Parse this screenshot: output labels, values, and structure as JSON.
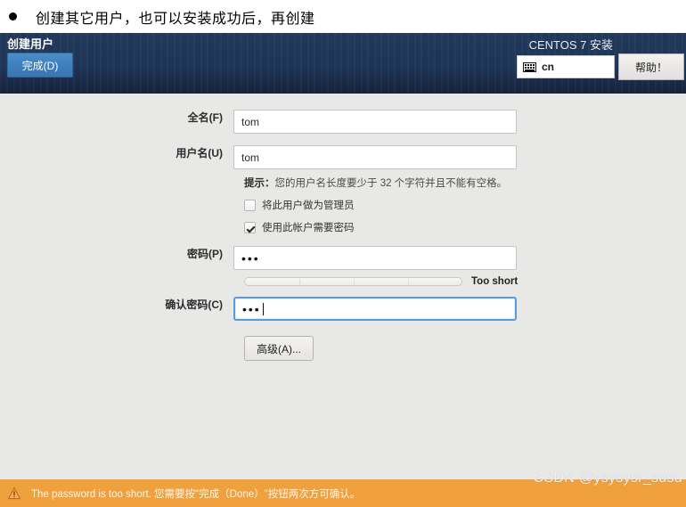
{
  "slide": {
    "bullet_text": "创建其它用户，也可以安装成功后，再创建",
    "bullet_icon": "bullet-dot-icon"
  },
  "header": {
    "title": "创建用户",
    "done_label": "完成(D)",
    "product_title": "CENTOS 7 安装",
    "keyboard_layout": "cn",
    "keyboard_icon": "keyboard-icon",
    "help_label": "帮助！",
    "bg_color": "#1e3557",
    "accent_color": "#3f81bd"
  },
  "form": {
    "fullname": {
      "label": "全名(F)",
      "value": "tom",
      "placeholder": ""
    },
    "username": {
      "label": "用户名(U)",
      "value": "tom",
      "placeholder": ""
    },
    "hint_prefix": "提示：",
    "hint_text": "您的用户名长度要少于 32 个字符并且不能有空格。",
    "admin_checkbox": {
      "label": "将此用户做为管理员",
      "checked": false
    },
    "require_password_checkbox": {
      "label": "使用此帐户需要密码",
      "checked": true
    },
    "password": {
      "label": "密码(P)",
      "value": "•••",
      "masked_length": 3
    },
    "strength": {
      "text": "Too short",
      "level": 0,
      "segments": 4
    },
    "confirm_password": {
      "label": "确认密码(C)",
      "value": "•••",
      "masked_length": 3,
      "focused": true
    },
    "advanced_label": "高级(A)..."
  },
  "status": {
    "icon": "warning-triangle-icon",
    "message": "The password is too short. 您需要按\"完成（Done）\"按钮两次方可确认。",
    "bar_color": "#f0a03c"
  },
  "watermark": {
    "text": "CSDN @ysysysr_susu"
  }
}
